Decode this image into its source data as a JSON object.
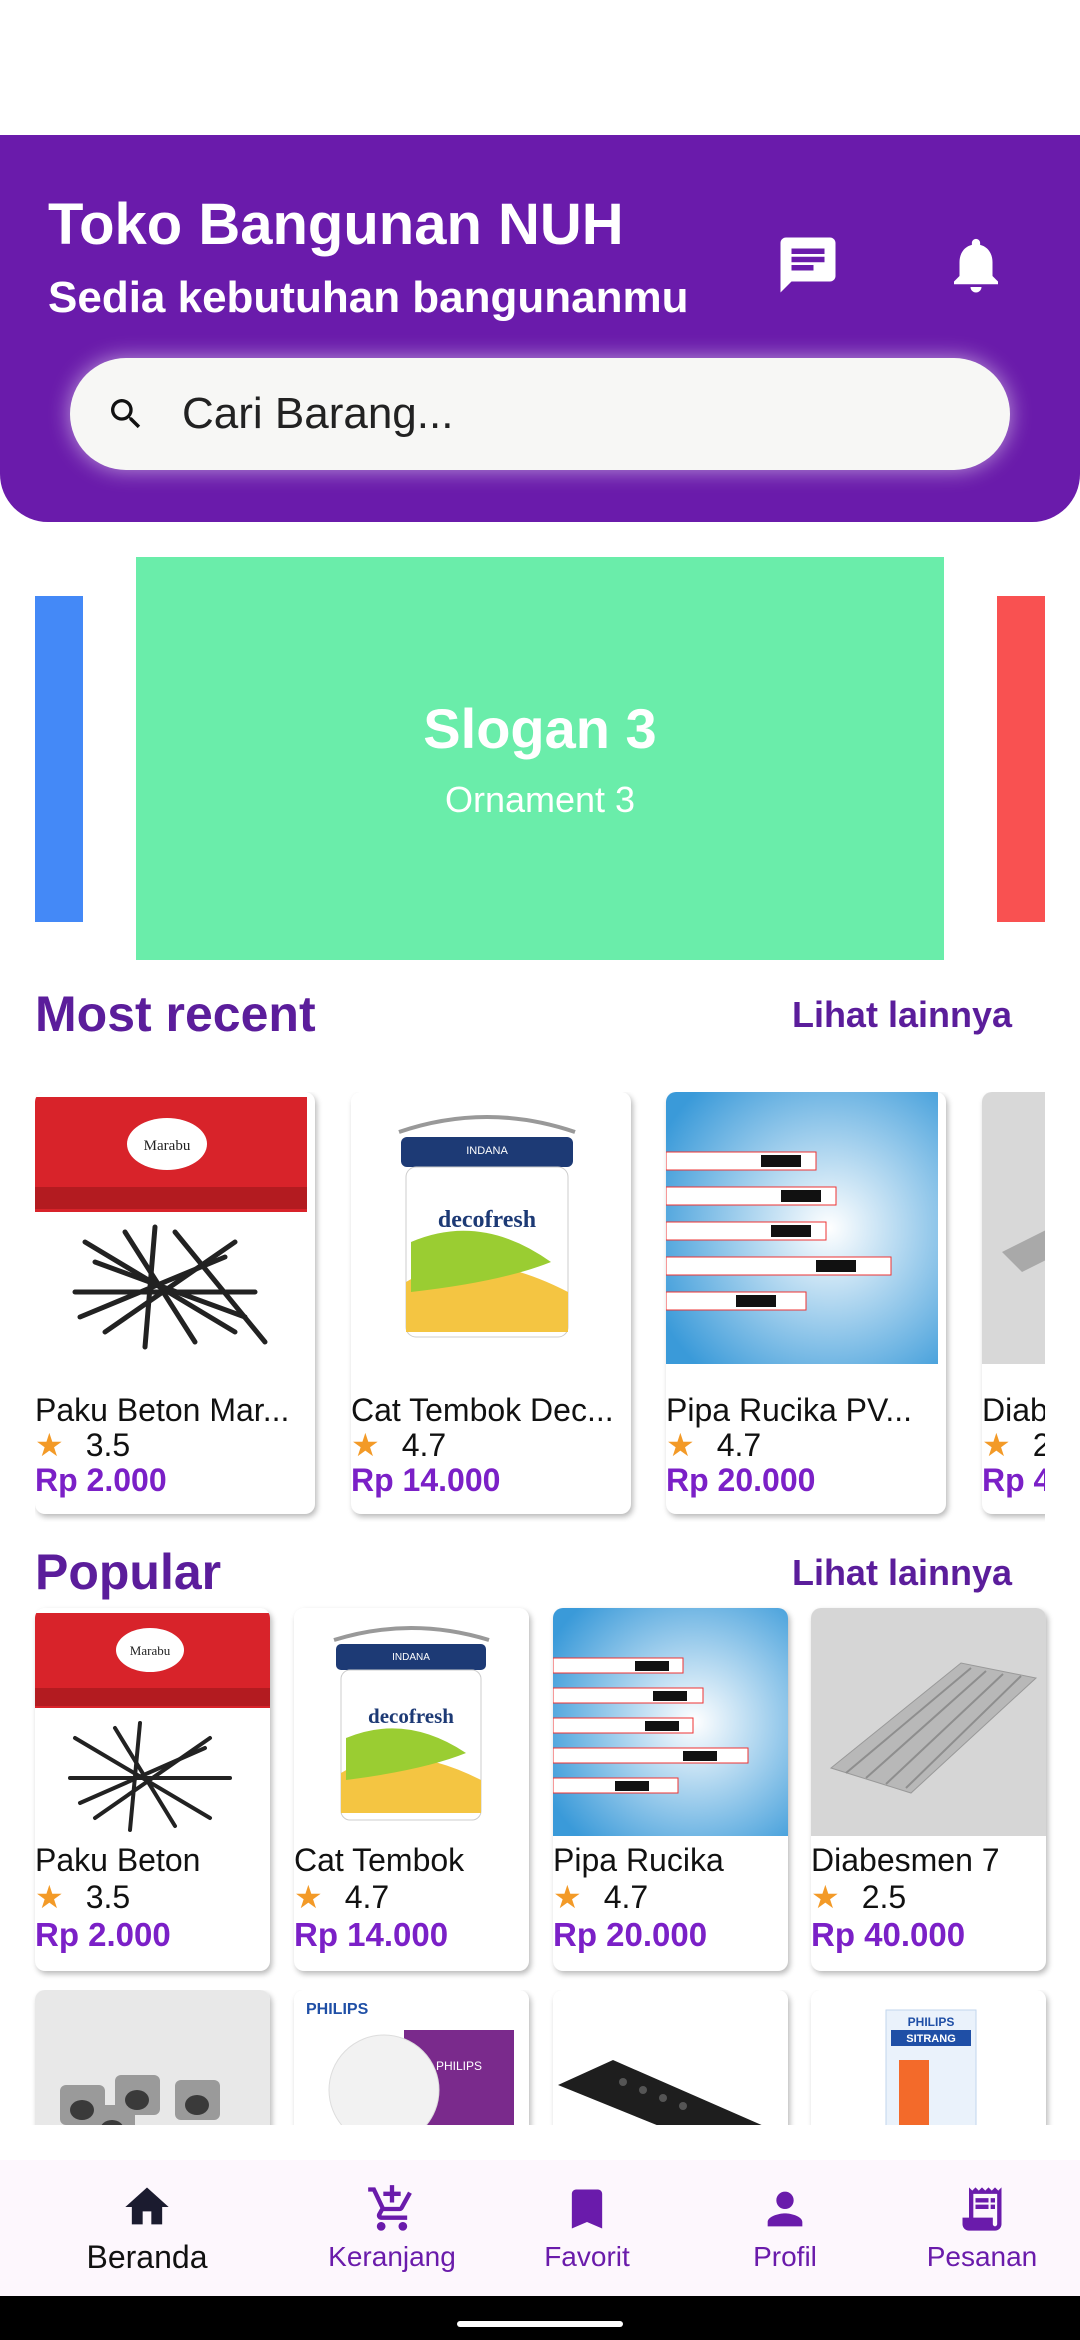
{
  "header": {
    "title": "Toko Bangunan NUH",
    "subtitle": "Sedia kebutuhan bangunanmu",
    "bg_color": "#6a1bab",
    "chat_icon": "chat-icon",
    "notification_icon": "bell-icon"
  },
  "search": {
    "placeholder": "Cari Barang..."
  },
  "carousel": {
    "title": "Slogan 3",
    "subtitle": "Ornament 3",
    "colors": [
      "#4489f7",
      "#6aedaa",
      "#f95151"
    ]
  },
  "most_recent": {
    "title": "Most recent",
    "see_more": "Lihat lainnya",
    "items": [
      {
        "name": "Paku Beton Mar...",
        "rating": "3.5",
        "price": "Rp 2.000"
      },
      {
        "name": "Cat Tembok Dec...",
        "rating": "4.7",
        "price": "Rp 14.000"
      },
      {
        "name": "Pipa Rucika PV...",
        "rating": "4.7",
        "price": "Rp 20.000"
      },
      {
        "name": "Diab",
        "rating": "2",
        "price": "Rp 4"
      }
    ]
  },
  "popular": {
    "title": "Popular",
    "see_more": "Lihat lainnya",
    "items": [
      {
        "name": "Paku Beton",
        "rating": "3.5",
        "price": "Rp 2.000"
      },
      {
        "name": "Cat Tembok",
        "rating": "4.7",
        "price": "Rp 14.000"
      },
      {
        "name": "Pipa Rucika",
        "rating": "4.7",
        "price": "Rp 20.000"
      },
      {
        "name": "Diabesmen 7",
        "rating": "2.5",
        "price": "Rp 40.000"
      }
    ]
  },
  "bottom_nav": {
    "items": [
      {
        "label": "Beranda",
        "icon": "home-icon",
        "active": true
      },
      {
        "label": "Keranjang",
        "icon": "cart-icon",
        "active": false
      },
      {
        "label": "Favorit",
        "icon": "bookmark-icon",
        "active": false
      },
      {
        "label": "Profil",
        "icon": "person-icon",
        "active": false
      },
      {
        "label": "Pesanan",
        "icon": "receipt-icon",
        "active": false
      }
    ]
  }
}
